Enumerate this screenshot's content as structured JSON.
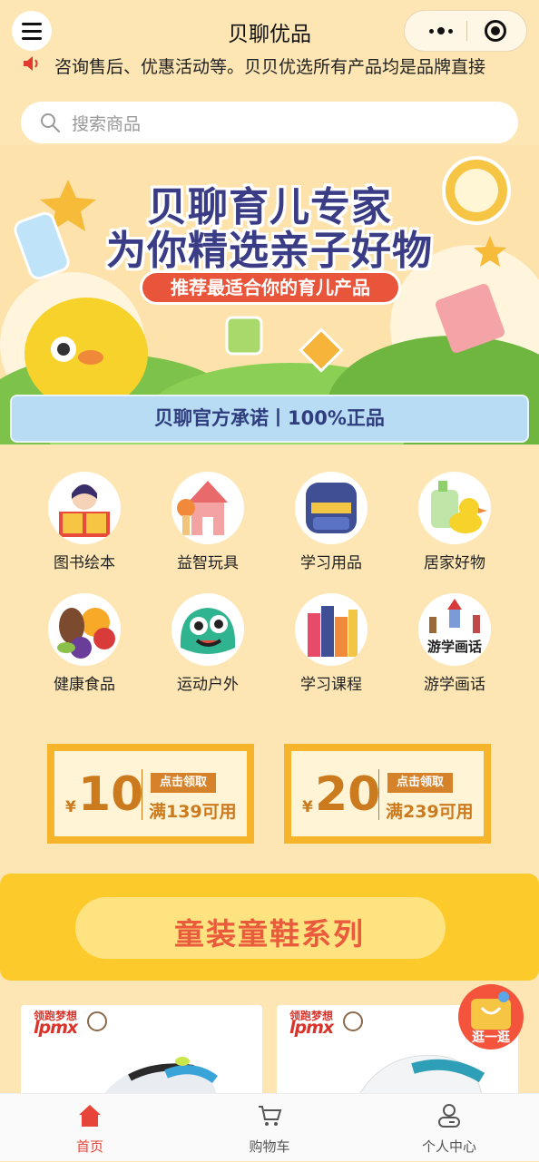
{
  "header": {
    "title": "贝聊优品"
  },
  "notice": {
    "text": "咨询售后、优惠活动等。贝贝优选所有产品均是品牌直接"
  },
  "search": {
    "placeholder": "搜索商品"
  },
  "banner": {
    "line1": "贝聊育儿专家",
    "line2": "为你精选亲子好物",
    "subtitle": "推荐最适合你的育儿产品",
    "promise": "贝聊官方承诺丨100%正品"
  },
  "categories": [
    {
      "label": "图书绘本",
      "icon": "picture-book-icon"
    },
    {
      "label": "益智玩具",
      "icon": "toy-blocks-icon"
    },
    {
      "label": "学习用品",
      "icon": "schoolbag-icon"
    },
    {
      "label": "居家好物",
      "icon": "home-goods-icon"
    },
    {
      "label": "健康食品",
      "icon": "fruit-icon"
    },
    {
      "label": "运动户外",
      "icon": "outdoor-monster-icon"
    },
    {
      "label": "学习课程",
      "icon": "books-icon"
    },
    {
      "label": "游学画话",
      "icon": "study-tour-icon",
      "img_text": "游学画话"
    }
  ],
  "coupons": [
    {
      "yen": "¥",
      "amount": "10",
      "tag": "点击领取",
      "condition": "满139可用"
    },
    {
      "yen": "¥",
      "amount": "20",
      "tag": "点击领取",
      "condition": "满239可用"
    }
  ],
  "series": {
    "title": "童装童鞋系列"
  },
  "products": [
    {
      "brand_cn": "领跑梦想",
      "brand_en": "lpmx"
    },
    {
      "brand_cn": "领跑梦想",
      "brand_en": "lpmx"
    }
  ],
  "float_button": {
    "label": "逛一逛"
  },
  "tabbar": [
    {
      "label": "首页",
      "icon": "home-icon",
      "active": true
    },
    {
      "label": "购物车",
      "icon": "cart-icon",
      "active": false
    },
    {
      "label": "个人中心",
      "icon": "profile-icon",
      "active": false
    }
  ],
  "colors": {
    "background": "#fde6b4",
    "accent": "#e8553a",
    "coupon": "#f6b42a",
    "active_tab": "#e8453a"
  }
}
